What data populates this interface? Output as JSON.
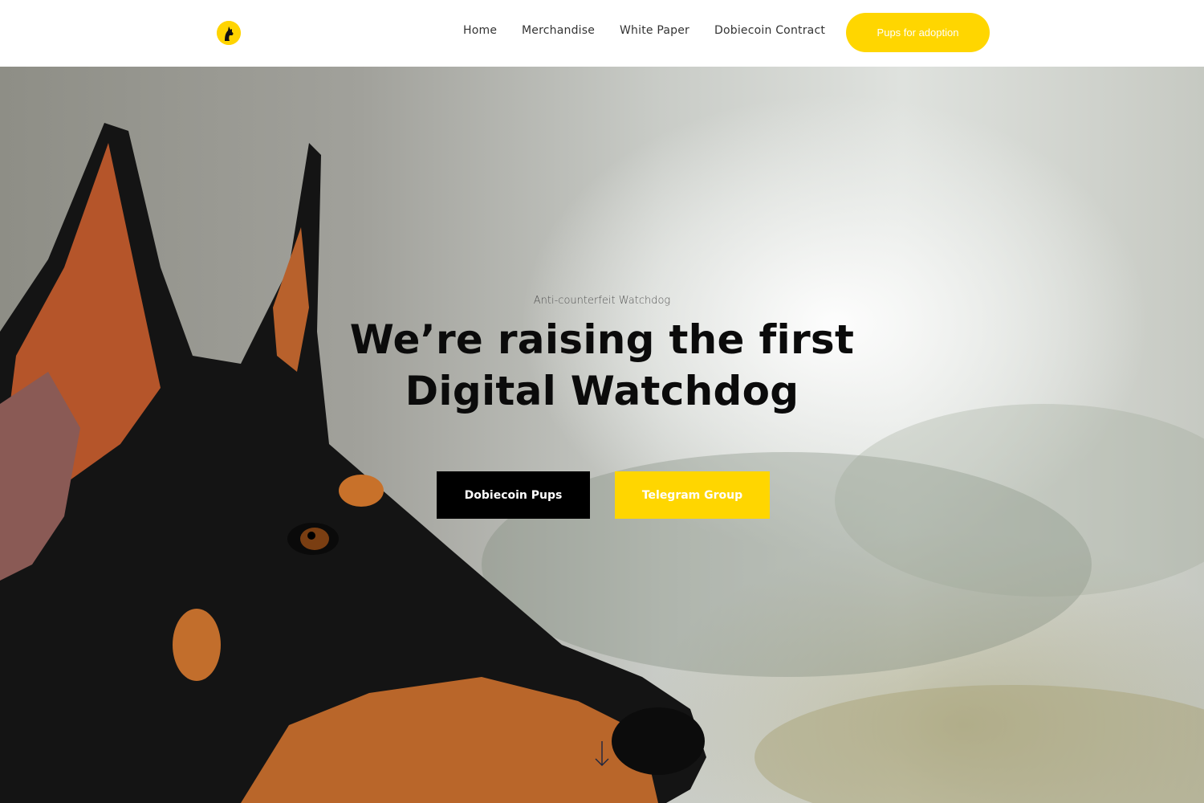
{
  "header": {
    "logo_icon": "doberman-head-logo-icon",
    "nav": {
      "home": "Home",
      "merchandise": "Merchandise",
      "white_paper": "White Paper",
      "contract": "Dobiecoin Contract"
    },
    "cta_label": "Pups for adoption"
  },
  "hero": {
    "background_image": "doberman-photo",
    "eyebrow": "Anti-counterfeit Watchdog",
    "title": "We’re raising the first Digital Watchdog",
    "primary_button": "Dobiecoin Pups",
    "secondary_button": "Telegram Group",
    "scroll_icon": "arrow-down-icon"
  },
  "colors": {
    "accent_yellow": "#ffd600",
    "primary_black": "#000000",
    "header_bg": "#ffffff"
  }
}
